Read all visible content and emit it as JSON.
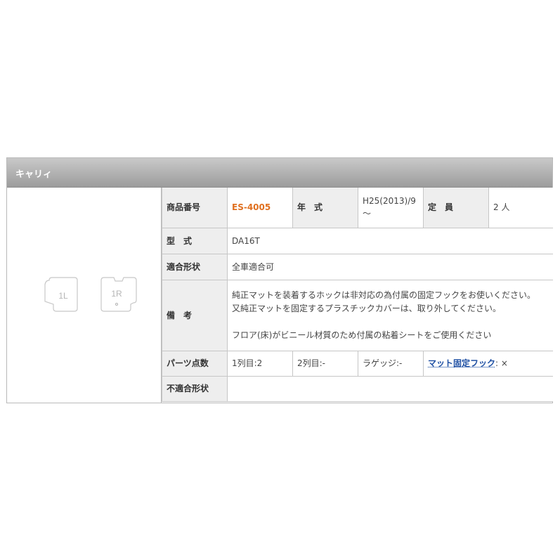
{
  "header": {
    "title": "キャリィ"
  },
  "mat_pieces": [
    "1L",
    "1R"
  ],
  "rows": {
    "product_no": {
      "label": "商品番号",
      "value": "ES-4005"
    },
    "year": {
      "label": "年　式",
      "value_line1": "H25(2013)/9",
      "value_line2": "～"
    },
    "capacity": {
      "label": "定　員",
      "value": "2 人"
    },
    "model": {
      "label": "型　式",
      "value": "DA16T"
    },
    "fit_shape": {
      "label": "適合形状",
      "value": "全車適合可"
    },
    "remarks": {
      "label": "備　考",
      "lines": [
        "純正マットを装着するホックは非対応の為付属の固定フックをお使いください。",
        "又純正マットを固定するプラスチックカバーは、取り外してください。",
        "フロア(床)がビニール材質のため付属の粘着シートをご使用ください"
      ]
    },
    "parts": {
      "label": "パーツ点数",
      "row1": "1列目:2",
      "row2": "2列目:-",
      "luggage": "ラゲッジ:-",
      "hook_link": "マット固定フック",
      "hook_value": ": ×"
    },
    "unfit": {
      "label": "不適合形状",
      "value": ""
    }
  }
}
